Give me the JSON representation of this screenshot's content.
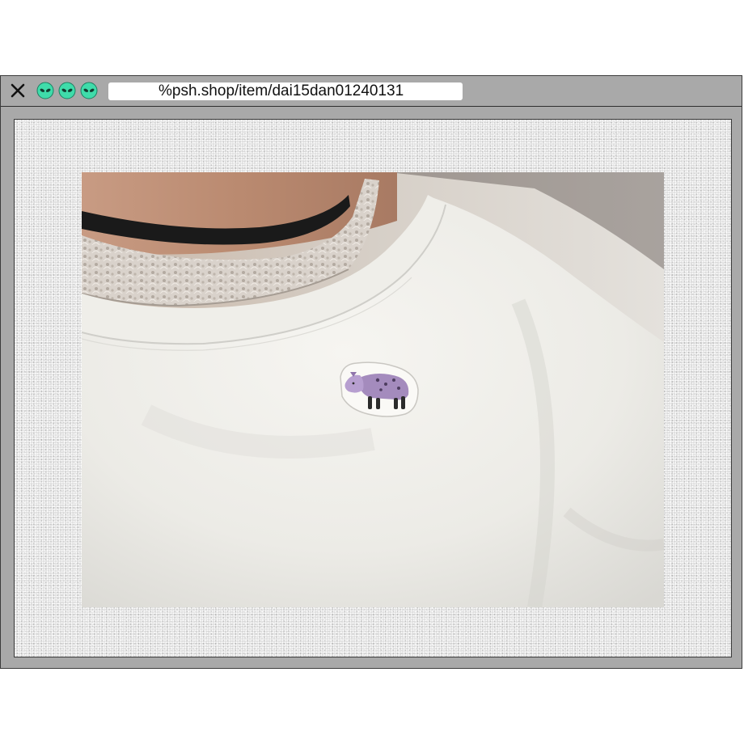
{
  "browser": {
    "url": "%psh.shop/item/dai15dan01240131",
    "controls": {
      "close_icon": "close-icon",
      "alien_icons": [
        "alien-icon",
        "alien-icon",
        "alien-icon"
      ]
    }
  },
  "colors": {
    "window_frame": "#a9a9a9",
    "alien_green": "#3fdcaa",
    "shirt_white": "#f3f2ee",
    "choker_black": "#1a1a1a",
    "patch_purple": "#a48bbd"
  },
  "product_photo": {
    "subject": "white-tshirt-with-hyena-patch"
  }
}
